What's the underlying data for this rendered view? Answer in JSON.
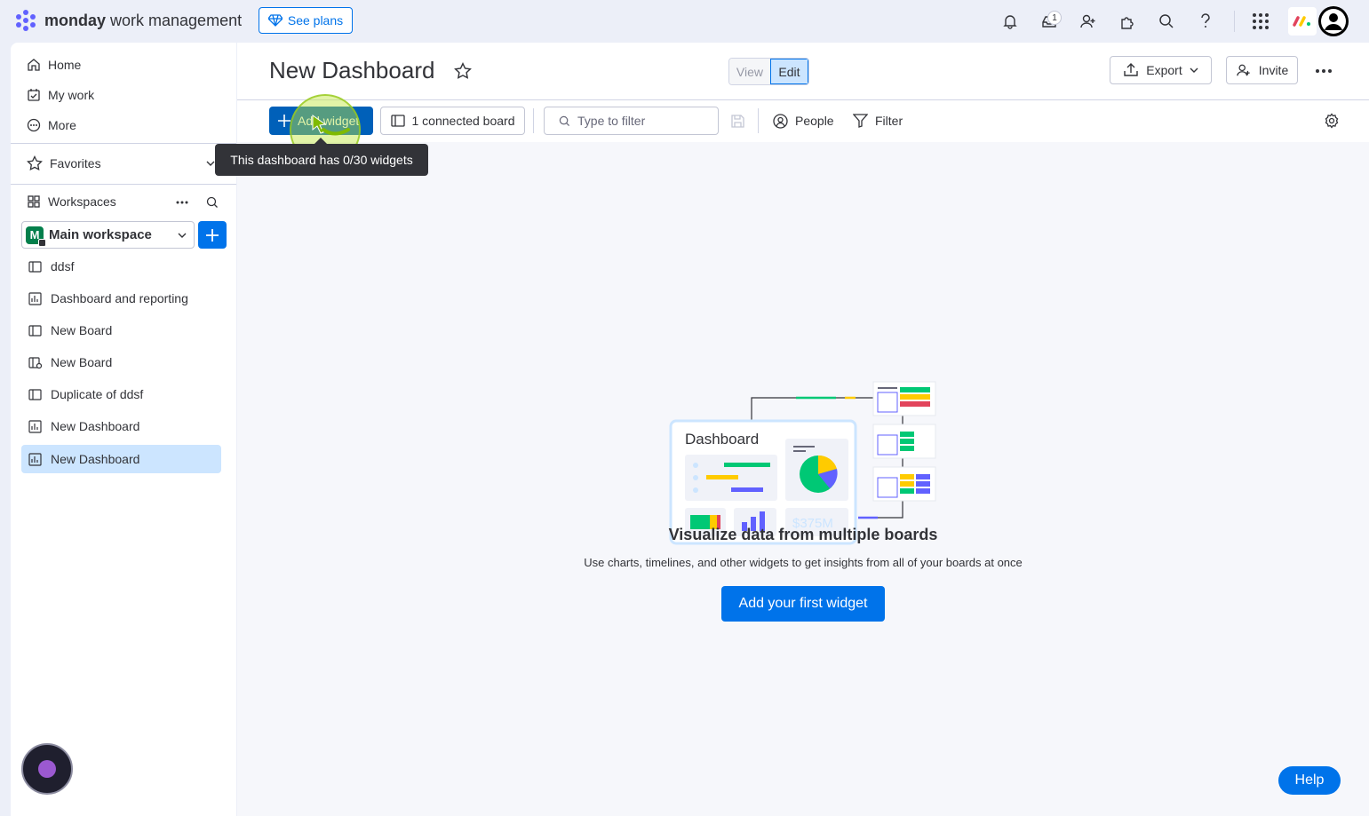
{
  "topbar": {
    "brand_bold": "monday",
    "brand_light": " work management",
    "see_plans": "See plans",
    "inbox_badge": "1",
    "icons": [
      "bell-icon",
      "inbox-icon",
      "invite-member-icon",
      "apps-icon",
      "search-icon",
      "help-icon",
      "app-switcher-icon",
      "monday-logo-icon",
      "avatar-icon"
    ]
  },
  "sidebar": {
    "nav": [
      {
        "label": "Home",
        "icon": "home-icon"
      },
      {
        "label": "My work",
        "icon": "calendar-check-icon"
      },
      {
        "label": "More",
        "icon": "more-circle-icon"
      }
    ],
    "favorites": "Favorites",
    "workspaces": "Workspaces",
    "workspace_letter": "M",
    "workspace_name": "Main workspace",
    "boards": [
      {
        "label": "ddsf",
        "icon": "board-icon"
      },
      {
        "label": "Dashboard and reporting",
        "icon": "dashboard-icon"
      },
      {
        "label": "New Board",
        "icon": "board-icon"
      },
      {
        "label": "New Board",
        "icon": "shared-board-icon"
      },
      {
        "label": "Duplicate of ddsf",
        "icon": "board-icon"
      },
      {
        "label": "New Dashboard",
        "icon": "dashboard-icon"
      },
      {
        "label": "New Dashboard",
        "icon": "dashboard-icon",
        "selected": true
      }
    ]
  },
  "main": {
    "title": "New Dashboard",
    "view": "View",
    "edit": "Edit",
    "export": "Export",
    "invite": "Invite",
    "add_widget": "Add widget",
    "connected_boards": "1 connected board",
    "filter_placeholder": "Type to filter",
    "people": "People",
    "filter": "Filter",
    "tooltip": "This dashboard has 0/30 widgets"
  },
  "empty_state": {
    "illustration_title": "Dashboard",
    "illustration_amount": "$375M",
    "heading": "Visualize data from multiple boards",
    "subheading": "Use charts, timelines, and other widgets to get insights from all of your boards at once",
    "cta": "Add your first widget"
  },
  "help": "Help",
  "colors": {
    "primary": "#0073ea",
    "selected": "#cce5ff",
    "green": "#00c875",
    "yellow": "#ffcb00",
    "purple": "#6161ff",
    "red": "#e2445c"
  }
}
